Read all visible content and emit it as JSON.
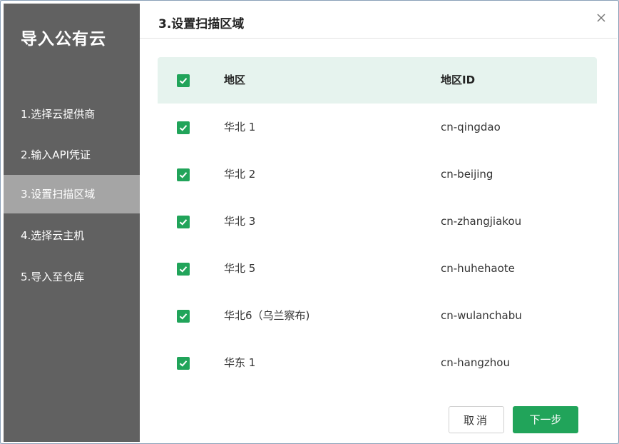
{
  "sidebar": {
    "title": "导入公有云",
    "steps": [
      {
        "label": "1.选择云提供商"
      },
      {
        "label": "2.输入API凭证"
      },
      {
        "label": "3.设置扫描区域"
      },
      {
        "label": "4.选择云主机"
      },
      {
        "label": "5.导入至仓库"
      }
    ],
    "active_step": 3
  },
  "dialog": {
    "title": "3.设置扫描区域",
    "close_icon": "close-icon"
  },
  "table": {
    "headers": {
      "region": "地区",
      "region_id": "地区ID"
    },
    "header_checked": true,
    "rows": [
      {
        "name": "华北 1",
        "id": "cn-qingdao",
        "checked": true
      },
      {
        "name": "华北 2",
        "id": "cn-beijing",
        "checked": true
      },
      {
        "name": "华北 3",
        "id": "cn-zhangjiakou",
        "checked": true
      },
      {
        "name": "华北 5",
        "id": "cn-huhehaote",
        "checked": true
      },
      {
        "name": "华北6（乌兰察布)",
        "id": "cn-wulanchabu",
        "checked": true
      },
      {
        "name": "华东 1",
        "id": "cn-hangzhou",
        "checked": true
      }
    ]
  },
  "footer": {
    "cancel_label": "取消",
    "next_label": "下一步"
  },
  "colors": {
    "accent": "#21a45a",
    "sidebar_bg": "#616161",
    "sidebar_active": "#a5a5a5",
    "table_header_bg": "#e6f3ee"
  }
}
